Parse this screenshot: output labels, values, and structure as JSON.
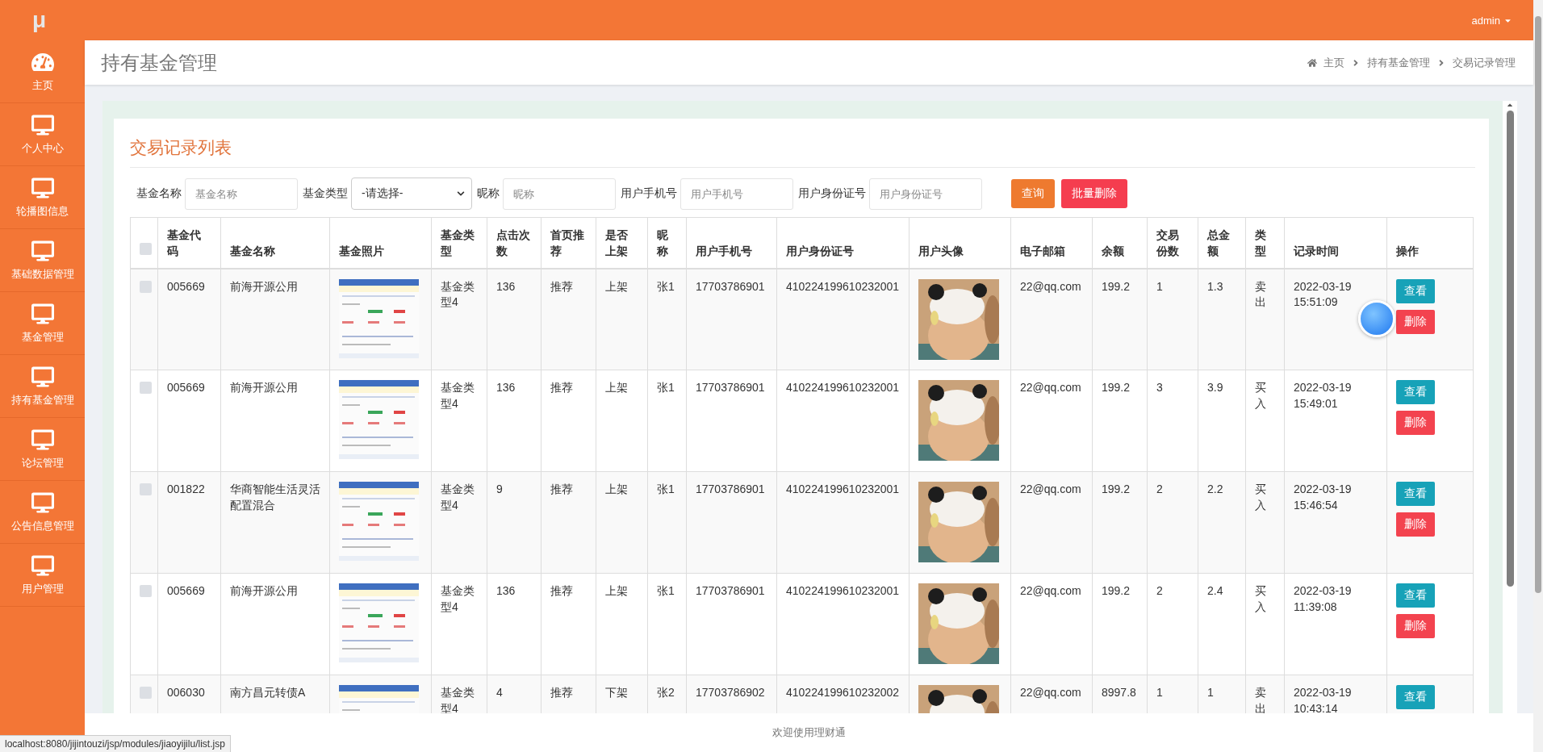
{
  "app": {
    "logo": "μ",
    "user": "admin"
  },
  "sidebar": {
    "items": [
      {
        "label": "主页",
        "kind": "home"
      },
      {
        "label": "个人中心",
        "kind": "module"
      },
      {
        "label": "轮播图信息",
        "kind": "module"
      },
      {
        "label": "基础数据管理",
        "kind": "module"
      },
      {
        "label": "基金管理",
        "kind": "module"
      },
      {
        "label": "持有基金管理",
        "kind": "module"
      },
      {
        "label": "论坛管理",
        "kind": "module"
      },
      {
        "label": "公告信息管理",
        "kind": "module"
      },
      {
        "label": "用户管理",
        "kind": "module"
      }
    ]
  },
  "page": {
    "title": "持有基金管理",
    "breadcrumb": [
      "主页",
      "持有基金管理",
      "交易记录管理"
    ]
  },
  "card": {
    "title": "交易记录列表"
  },
  "filters": [
    {
      "kind": "input",
      "label": "基金名称",
      "placeholder": "基金名称"
    },
    {
      "kind": "select",
      "label": "基金类型",
      "value": "-请选择-"
    },
    {
      "kind": "input",
      "label": "昵称",
      "placeholder": "昵称"
    },
    {
      "kind": "input",
      "label": "用户手机号",
      "placeholder": "用户手机号"
    },
    {
      "kind": "input",
      "label": "用户身份证号",
      "placeholder": "用户身份证号"
    }
  ],
  "filter_buttons": [
    {
      "label": "查询",
      "kind": "primary"
    },
    {
      "label": "批量删除",
      "kind": "danger"
    }
  ],
  "table": {
    "select_all": {
      "checked": false
    },
    "columns": [
      {
        "label": "基金代码",
        "kind": "text"
      },
      {
        "label": "基金名称",
        "kind": "text"
      },
      {
        "label": "基金照片",
        "kind": "fund_photo"
      },
      {
        "label": "基金类型",
        "kind": "text"
      },
      {
        "label": "点击次数",
        "kind": "text"
      },
      {
        "label": "首页推荐",
        "kind": "text"
      },
      {
        "label": "是否上架",
        "kind": "text"
      },
      {
        "label": "昵称",
        "kind": "text"
      },
      {
        "label": "用户手机号",
        "kind": "text"
      },
      {
        "label": "用户身份证号",
        "kind": "text"
      },
      {
        "label": "用户头像",
        "kind": "avatar"
      },
      {
        "label": "电子邮箱",
        "kind": "text"
      },
      {
        "label": "余额",
        "kind": "text"
      },
      {
        "label": "交易份数",
        "kind": "text"
      },
      {
        "label": "总金额",
        "kind": "text"
      },
      {
        "label": "类型",
        "kind": "text"
      },
      {
        "label": "记录时间",
        "kind": "text"
      },
      {
        "label": "操作",
        "kind": "actions"
      }
    ],
    "rows": [
      {
        "checked": false,
        "cells": [
          "005669",
          "前海开源公用",
          {
            "kind": "picture"
          },
          "基金类型4",
          "136",
          "推荐",
          "上架",
          "张1",
          "17703786901",
          "410224199610232001",
          {
            "kind": "picture"
          },
          "22@qq.com",
          "199.2",
          "1",
          "1.3",
          "卖出",
          "2022-03-19 15:51:09",
          [
            {
              "label": "查看",
              "kind": "view"
            },
            {
              "label": "删除",
              "kind": "delete"
            }
          ]
        ]
      },
      {
        "checked": false,
        "cells": [
          "005669",
          "前海开源公用",
          {
            "kind": "picture"
          },
          "基金类型4",
          "136",
          "推荐",
          "上架",
          "张1",
          "17703786901",
          "410224199610232001",
          {
            "kind": "picture"
          },
          "22@qq.com",
          "199.2",
          "3",
          "3.9",
          "买入",
          "2022-03-19 15:49:01",
          [
            {
              "label": "查看",
              "kind": "view"
            },
            {
              "label": "删除",
              "kind": "delete"
            }
          ]
        ]
      },
      {
        "checked": false,
        "cells": [
          "001822",
          "华商智能生活灵活配置混合",
          {
            "kind": "picture"
          },
          "基金类型4",
          "9",
          "推荐",
          "上架",
          "张1",
          "17703786901",
          "410224199610232001",
          {
            "kind": "picture"
          },
          "22@qq.com",
          "199.2",
          "2",
          "2.2",
          "买入",
          "2022-03-19 15:46:54",
          [
            {
              "label": "查看",
              "kind": "view"
            },
            {
              "label": "删除",
              "kind": "delete"
            }
          ]
        ]
      },
      {
        "checked": false,
        "cells": [
          "005669",
          "前海开源公用",
          {
            "kind": "picture"
          },
          "基金类型4",
          "136",
          "推荐",
          "上架",
          "张1",
          "17703786901",
          "410224199610232001",
          {
            "kind": "picture"
          },
          "22@qq.com",
          "199.2",
          "2",
          "2.4",
          "买入",
          "2022-03-19 11:39:08",
          [
            {
              "label": "查看",
              "kind": "view"
            },
            {
              "label": "删除",
              "kind": "delete"
            }
          ]
        ]
      },
      {
        "checked": false,
        "cells": [
          "006030",
          "南方昌元转债A",
          {
            "kind": "picture"
          },
          "基金类型4",
          "4",
          "推荐",
          "下架",
          "张2",
          "17703786902",
          "410224199610232002",
          {
            "kind": "picture"
          },
          "22@qq.com",
          "8997.8",
          "1",
          "1",
          "卖出",
          "2022-03-19 10:43:14",
          [
            {
              "label": "查看",
              "kind": "view"
            }
          ]
        ]
      }
    ]
  },
  "footer": {
    "text": "欢迎使用理财通"
  },
  "status_bar": {
    "url": "localhost:8080/jijintouzi/jsp/modules/jiaoyijilu/list.jsp"
  }
}
